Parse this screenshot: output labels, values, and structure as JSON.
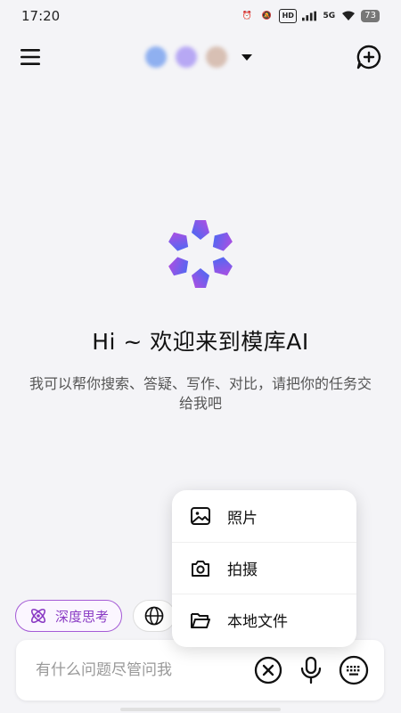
{
  "status_bar": {
    "time": "17:20",
    "network": "5G",
    "hd": "HD",
    "battery": "73"
  },
  "header": {
    "menu_icon": "hamburger-menu-icon",
    "new_chat_icon": "new-chat-icon"
  },
  "hero": {
    "title": "Hi ~ 欢迎来到模库AI",
    "subtitle": "我可以帮你搜索、答疑、写作、对比，请把你的任务交给我吧"
  },
  "chips": {
    "deep_think_label": "深度思考"
  },
  "input": {
    "placeholder": "有什么问题尽管问我"
  },
  "popup": {
    "items": [
      {
        "label": "照片",
        "icon": "image-icon"
      },
      {
        "label": "拍摄",
        "icon": "camera-icon"
      },
      {
        "label": "本地文件",
        "icon": "folder-icon"
      }
    ]
  },
  "colors": {
    "accent_purple": "#8a3bc4",
    "logo_blue": "#3f6df5",
    "logo_purple": "#b54ce0",
    "background": "#f4f4f7"
  }
}
